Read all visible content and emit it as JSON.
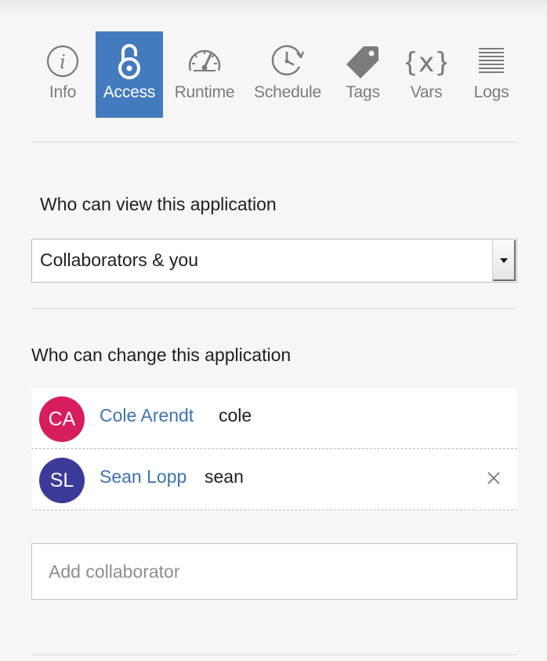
{
  "tabs": [
    {
      "label": "Info",
      "icon": "info-icon",
      "active": false
    },
    {
      "label": "Access",
      "icon": "lock-icon",
      "active": true
    },
    {
      "label": "Runtime",
      "icon": "gauge-icon",
      "active": false
    },
    {
      "label": "Schedule",
      "icon": "clock-icon",
      "active": false
    },
    {
      "label": "Tags",
      "icon": "tag-icon",
      "active": false
    },
    {
      "label": "Vars",
      "icon": "variable-icon",
      "active": false
    },
    {
      "label": "Logs",
      "icon": "logs-icon",
      "active": false
    }
  ],
  "view_access": {
    "heading": "Who can view this application",
    "selected": "Collaborators & you"
  },
  "change_access": {
    "heading": "Who can change this application",
    "collaborators": [
      {
        "initials": "CA",
        "name": "Cole Arendt",
        "username": "cole",
        "color": "#d81d5e",
        "removable": false
      },
      {
        "initials": "SL",
        "name": "Sean Lopp",
        "username": "sean",
        "color": "#3c3a99",
        "removable": true
      }
    ],
    "add_placeholder": "Add collaborator"
  },
  "colors": {
    "accent": "#447bbf",
    "link": "#3b73ac"
  }
}
